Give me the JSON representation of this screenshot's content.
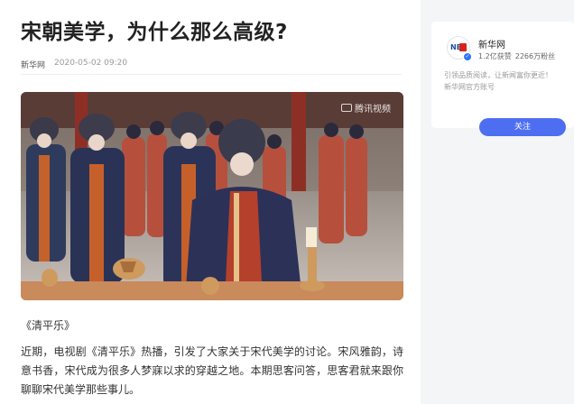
{
  "article": {
    "title": "宋朝美学，为什么那么高级?",
    "source": "新华网",
    "time": "2020-05-02 09:20",
    "watermark": "腾讯视频",
    "watermark_icon": "video-play-icon",
    "caption": "《清平乐》",
    "paragraph": "近期，电视剧《清平乐》热播，引发了大家关于宋代美学的讨论。宋风雅韵，诗意书香，宋代成为很多人梦寐以求的穿越之地。本期思客问答，思客君就来跟你聊聊宋代美学那些事儿。"
  },
  "author_card": {
    "logo_text": "NE",
    "name": "新华网",
    "likes": "1.2亿获赞",
    "fans": "2266万粉丝",
    "desc_line1": "引领品质阅读，让新闻富你更近！",
    "desc_line2": "新华网官方账号",
    "follow_label": "关注",
    "accent": "#4e6ef2"
  }
}
